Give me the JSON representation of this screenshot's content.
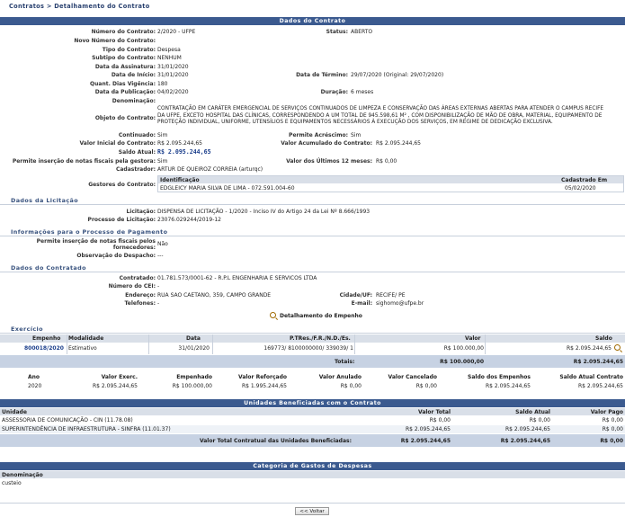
{
  "breadcrumb": "Contratos > Detalhamento do Contrato",
  "sections": {
    "dados_contrato": "Dados do Contrato",
    "licitacao": "Dados da Licitação",
    "pagamento": "Informações para o Processo de Pagamento",
    "contratado": "Dados do Contratado",
    "exercicio": "Exercício",
    "unidades": "Unidades Beneficiadas com o Contrato",
    "categoria": "Categoria de Gastos de Despesas"
  },
  "contrato": {
    "numero_l": "Número do Contrato:",
    "numero": "2/2020 - UFPE",
    "status_l": "Status:",
    "status": "ABERTO",
    "novo_numero_l": "Novo Número do Contrato:",
    "tipo_l": "Tipo do Contrato:",
    "tipo": "Despesa",
    "subtipo_l": "Subtipo do Contrato:",
    "subtipo": "NENHUM",
    "assinatura_l": "Data da Assinatura:",
    "assinatura": "31/01/2020",
    "inicio_l": "Data de Início:",
    "inicio": "31/01/2020",
    "termino_l": "Data de Término:",
    "termino": "29/07/2020 (Original: 29/07/2020)",
    "dias_l": "Quant. Dias Vigência:",
    "dias": "180",
    "publicacao_l": "Data da Publicação:",
    "publicacao": "04/02/2020",
    "duracao_l": "Duração:",
    "duracao": "6 meses",
    "denominacao_l": "Denominação:",
    "objeto_l": "Objeto do Contrato:",
    "objeto": "CONTRATAÇÃO EM CARÁTER EMERGENCIAL DE SERVIÇOS CONTINUADOS DE LIMPEZA E CONSERVAÇÃO DAS ÁREAS EXTERNAS ABERTAS PARA ATENDER O CAMPUS RECIFE DA UFPE, EXCETO HOSPITAL DAS CLÍNICAS, CORRESPONDENDO A UM TOTAL DE 945.598,61 M² , COM DISPONIBILIZAÇÃO DE MÃO DE OBRA, MATERIAL, EQUIPAMENTO DE PROTEÇÃO INDIVIDUAL, UNIFORME, UTENSÍLIOS E EQUIPAMENTOS NECESSÁRIOS À EXECUÇÃO DOS SERVIÇOS, EM REGIME DE DEDICAÇÃO EXCLUSIVA.",
    "continuado_l": "Continuado:",
    "continuado": "Sim",
    "acrescimo_l": "Permite Acréscimo:",
    "acrescimo": "Sim",
    "valor_inicial_l": "Valor Inicial do Contrato:",
    "valor_inicial": "R$ 2.095.244,65",
    "valor_acumulado_l": "Valor Acumulado do Contrato:",
    "valor_acumulado": "R$ 2.095.244,65",
    "saldo_l": "Saldo Atual:",
    "saldo": "R$ 2.095.244,65",
    "notas_gestora_l": "Permite inserção de notas fiscais pela gestora:",
    "notas_gestora": "Sim",
    "ultimos12_l": "Valor dos Últimos 12 meses:",
    "ultimos12": "R$ 0,00",
    "cadastrador_l": "Cadastrador:",
    "cadastrador": "ARTUR DE QUEIROZ CORREIA (arturqc)",
    "gestores_l": "Gestores do Contrato:",
    "gestores_h1": "Identificação",
    "gestores_h2": "Cadastrado Em",
    "gestor_nome": "EDGLEICY MARIA SILVA DE LIMA - 072.591.004-60",
    "gestor_data": "05/02/2020"
  },
  "licitacao": {
    "lic_l": "Licitação:",
    "lic": "DISPENSA DE LICITAÇÃO - 1/2020 - Inciso IV do Artigo 24 da Lei Nº 8.666/1993",
    "proc_l": "Processo de Licitação:",
    "proc": "23076.029244/2019-12"
  },
  "pagamento": {
    "notas_l1": "Permite inserção de notas fiscais pelos",
    "notas_l2": "fornecedores:",
    "notas": "Não",
    "obs_l": "Observação do Despacho:",
    "obs": "---"
  },
  "contratado": {
    "contratado_l": "Contratado:",
    "contratado": "01.781.573/0001-62 - R.P.L ENGENHARIA E SERVICOS LTDA",
    "cei_l": "Número do CEI:",
    "cei": "-",
    "endereco_l": "Endereço:",
    "endereco": "RUA SAO CAETANO, 359, CAMPO GRANDE",
    "cidade_l": "Cidade/UF:",
    "cidade": "RECIFE/ PE",
    "tel_l": "Telefones:",
    "tel": "-",
    "email_l": "E-mail:",
    "email": "sighomo@ufpe.br",
    "det_empenho": "Detalhamento do Empenho"
  },
  "empenho": {
    "headers": [
      "Empenho",
      "Modalidade",
      "Data",
      "P.TRes./F.R./N.D./Es.",
      "Valor",
      "Saldo"
    ],
    "row": [
      "800018/2020",
      "Estimativo",
      "31/01/2020",
      "169773/ 8100000000/ 339039/ 1",
      "R$ 100.000,00",
      "R$ 2.095.244,65"
    ],
    "totais_l": "Totais:",
    "totais_valor": "R$ 100.000,00",
    "totais_saldo": "R$ 2.095.244,65"
  },
  "exercicio": {
    "headers": [
      "Ano",
      "Valor Exerc.",
      "Empenhado",
      "Valor Reforçado",
      "Valor Anulado",
      "Valor Cancelado",
      "Saldo dos Empenhos",
      "Saldo Atual Contrato"
    ],
    "row": [
      "2020",
      "R$ 2.095.244,65",
      "R$ 100.000,00",
      "R$ 1.995.244,65",
      "R$ 0,00",
      "R$ 0,00",
      "R$ 2.095.244,65",
      "R$ 2.095.244,65"
    ]
  },
  "unidades": {
    "headers": [
      "Unidade",
      "Valor Total",
      "Saldo Atual",
      "Valor Pago"
    ],
    "rows": [
      [
        "ASSESSORIA DE COMUNICAÇÃO - CIN (11.78.08)",
        "R$ 0,00",
        "R$ 0,00",
        "R$ 0,00"
      ],
      [
        "SUPERINTENDÊNCIA DE INFRAESTRUTURA - SINFRA (11.01.37)",
        "R$ 2.095.244,65",
        "R$ 2.095.244,65",
        "R$ 0,00"
      ]
    ],
    "total_l": "Valor Total Contratual das Unidades Beneficiadas:",
    "total": [
      "R$ 2.095.244,65",
      "R$ 2.095.244,65",
      "R$ 0,00"
    ]
  },
  "categoria": {
    "header": "Denominação",
    "value": "custeio"
  },
  "voltar": "<< Voltar"
}
